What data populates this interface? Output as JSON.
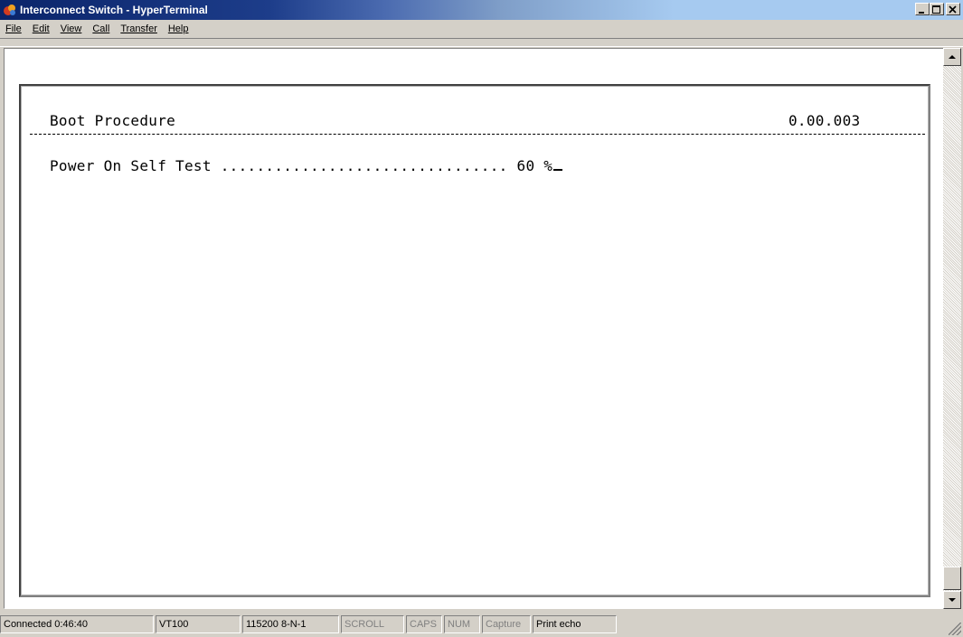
{
  "window": {
    "title": "Interconnect Switch - HyperTerminal",
    "icon": "hyperterminal-app-icon"
  },
  "menu": [
    {
      "label": "File",
      "accel": "F"
    },
    {
      "label": "Edit",
      "accel": "E"
    },
    {
      "label": "View",
      "accel": "V"
    },
    {
      "label": "Call",
      "accel": "C"
    },
    {
      "label": "Transfer",
      "accel": "T"
    },
    {
      "label": "Help",
      "accel": "H"
    }
  ],
  "terminal": {
    "heading": "Boot Procedure",
    "version": "0.00.003",
    "progress_label": "Power On Self Test ................................ 60 %",
    "progress_percent": 60
  },
  "status": {
    "connected": "Connected 0:46:40",
    "emulation": "VT100",
    "port_settings": "115200 8-N-1",
    "scroll": "SCROLL",
    "caps": "CAPS",
    "num": "NUM",
    "capture": "Capture",
    "print_echo": "Print echo"
  }
}
